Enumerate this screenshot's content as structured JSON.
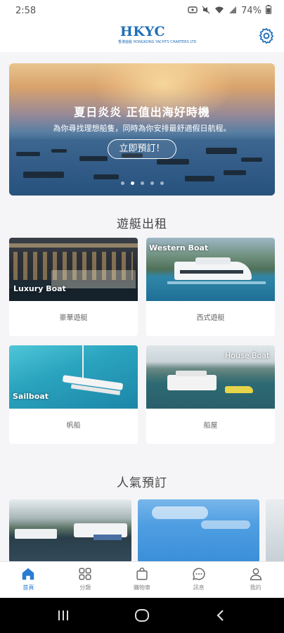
{
  "status_bar": {
    "time": "2:58",
    "battery": "74%"
  },
  "header": {
    "logo_text": "HKYC",
    "logo_subtitle": "香港遊艇 HONGKONG YACHTS CHARTERS LTD"
  },
  "banner": {
    "title": "夏日炎炎 正值出海好時機",
    "subtitle": "為你尋找理想船隻，同時為你安排最舒適假日航程。",
    "button_label": "立即預訂！",
    "dot_count": 5,
    "active_dot": 1
  },
  "rental": {
    "section_title": "遊艇出租",
    "cards": [
      {
        "image_label": "Luxury Boat",
        "caption": "豪華遊艇"
      },
      {
        "image_label": "Western Boat",
        "caption": "西式遊艇"
      },
      {
        "image_label": "Sailboat",
        "caption": "帆船"
      },
      {
        "image_label": "House Boat",
        "caption": "船屋"
      }
    ]
  },
  "popular": {
    "section_title": "人氣預訂"
  },
  "bottom_nav": {
    "items": [
      {
        "label": "首頁",
        "icon": "home-icon"
      },
      {
        "label": "分類",
        "icon": "grid-icon"
      },
      {
        "label": "購物車",
        "icon": "bag-icon"
      },
      {
        "label": "訊息",
        "icon": "chat-icon"
      },
      {
        "label": "我的",
        "icon": "person-icon"
      }
    ],
    "active_index": 0
  },
  "colors": {
    "accent": "#2a7bd3",
    "logo": "#1f6fb8"
  }
}
